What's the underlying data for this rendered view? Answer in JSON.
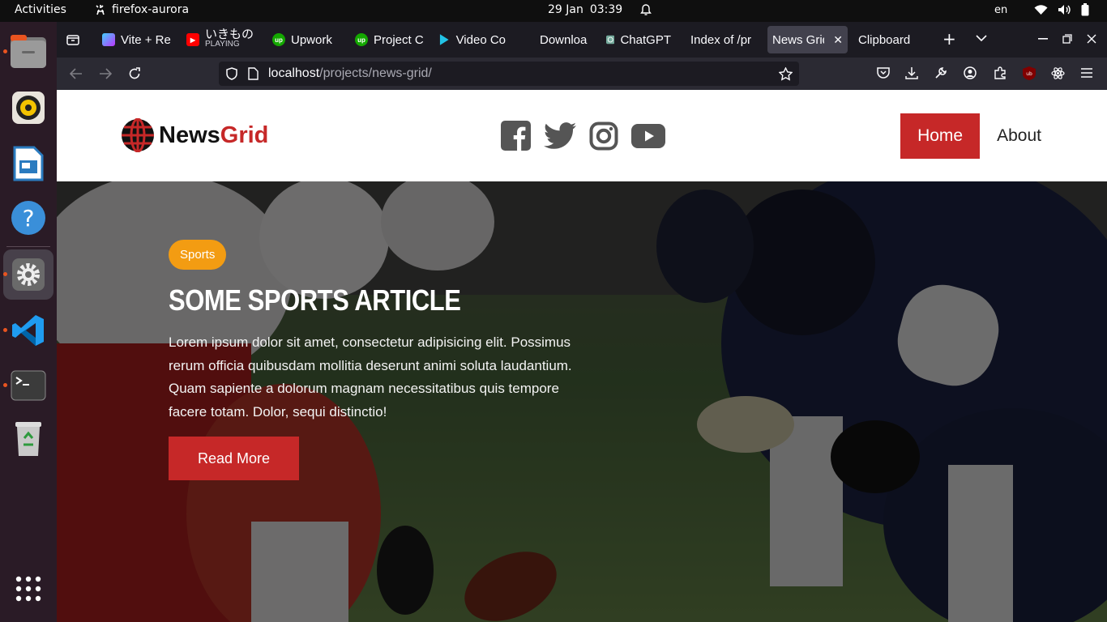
{
  "os": {
    "activities": "Activities",
    "app_name": "firefox-aurora",
    "date": "29 Jan",
    "time": "03:39",
    "language": "en",
    "dock": [
      {
        "icon": "files-icon",
        "running": true
      },
      {
        "icon": "rhythmbox-icon",
        "running": false
      },
      {
        "icon": "libreoffice-impress-icon",
        "running": false
      },
      {
        "icon": "help-icon",
        "running": false
      },
      {
        "icon": "settings-icon",
        "running": true,
        "selected": true
      },
      {
        "icon": "vscode-icon",
        "running": true
      },
      {
        "icon": "terminal-icon",
        "running": true
      },
      {
        "icon": "trash-icon",
        "running": false
      },
      {
        "icon": "show-apps-icon",
        "running": false
      }
    ]
  },
  "browser": {
    "tabs": [
      {
        "label": "Vite + Re",
        "favicon": "vite-icon"
      },
      {
        "label": "いきもの",
        "sub": "PLAYING",
        "favicon": "youtube-icon"
      },
      {
        "label": "Upwork",
        "favicon": "upwork-icon"
      },
      {
        "label": "Project C",
        "favicon": "upwork-icon"
      },
      {
        "label": "Video Co",
        "favicon": "video-icon"
      },
      {
        "label": "Downloa",
        "favicon": ""
      },
      {
        "label": "ChatGPT",
        "favicon": "chatgpt-icon"
      },
      {
        "label": "Index of /pr",
        "favicon": ""
      },
      {
        "label": "News Grid",
        "favicon": "",
        "active": true
      },
      {
        "label": "Clipboard",
        "favicon": ""
      }
    ],
    "url_host": "localhost",
    "url_path": "/projects/news-grid/"
  },
  "site": {
    "logo_part1": "News",
    "logo_part2": "Grid",
    "social": [
      "facebook-icon",
      "twitter-icon",
      "instagram-icon",
      "youtube-icon"
    ],
    "nav": [
      {
        "label": "Home",
        "current": true
      },
      {
        "label": "About",
        "current": false
      }
    ]
  },
  "hero": {
    "category": "Sports",
    "title": "Some Sports Article",
    "excerpt": "Lorem ipsum dolor sit amet, consectetur adipisicing elit. Possimus rerum officia quibusdam mollitia deserunt animi soluta laudantium. Quam sapiente a dolorum magnam necessitatibus quis tempore facere totam. Dolor, sequi distinctio!",
    "button": "Read More"
  },
  "colors": {
    "brand_red": "#c62828",
    "category_orange": "#f39c12"
  }
}
